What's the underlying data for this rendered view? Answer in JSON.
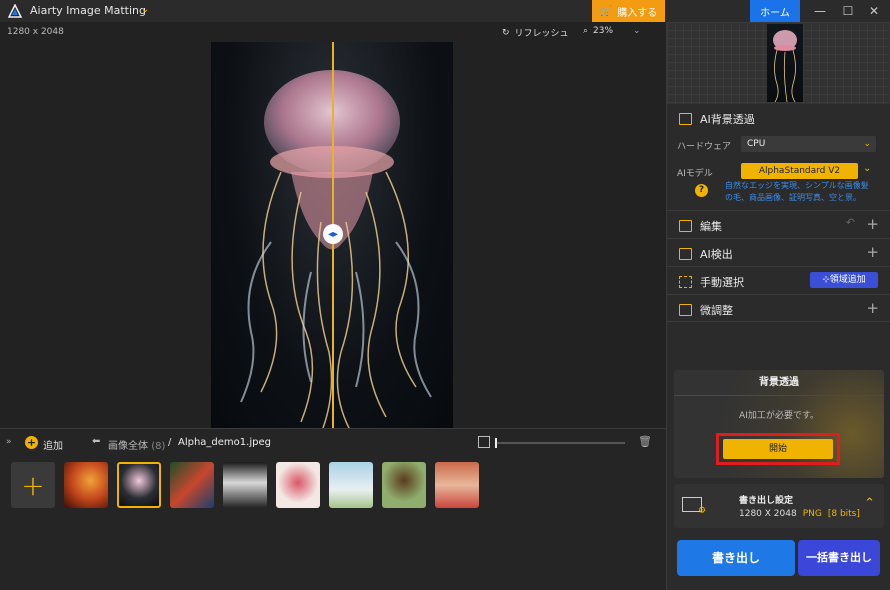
{
  "titlebar": {
    "app_title": "Aiarty Image Matting",
    "buy_label": "購入する",
    "home_tab": "ホーム",
    "min": "—",
    "max": "☐",
    "close": "✕"
  },
  "canvas": {
    "dimensions": "1280 x 2048",
    "refresh_label": "リフレッシュ",
    "zoom_value": "23%"
  },
  "bottom": {
    "add_label": "追加",
    "crumb_all": "画像全体",
    "crumb_count": "(8)",
    "crumb_sep": "/",
    "file_name": "Alpha_demo1.jpeg"
  },
  "panel": {
    "ai_section_title": "AI背景透過",
    "hardware_label": "ハードウェア",
    "hardware_value": "CPU",
    "model_label": "AIモデル",
    "model_value": "AlphaStandard  V2",
    "model_desc": "自然なエッジを実現、シンプルな画像髪の毛、商品画像、証明写真、空と景。",
    "edit_title": "編集",
    "detect_title": "AI検出",
    "manual_title": "手動選択",
    "region_btn": "領域追加",
    "fine_title": "微調整",
    "bg_title": "背景透過",
    "bg_msg": "AI加工が必要です。",
    "start_btn": "開始",
    "export_title": "書き出し設定",
    "export_size": "1280 X 2048",
    "export_format": "PNG",
    "export_bits": "[8 bits]",
    "export_btn": "書き出し",
    "batch_btn": "一括書き出し"
  },
  "colors": {
    "accent": "#f0b400",
    "blue": "#1e78e6",
    "highlight": "#e01d1d"
  }
}
